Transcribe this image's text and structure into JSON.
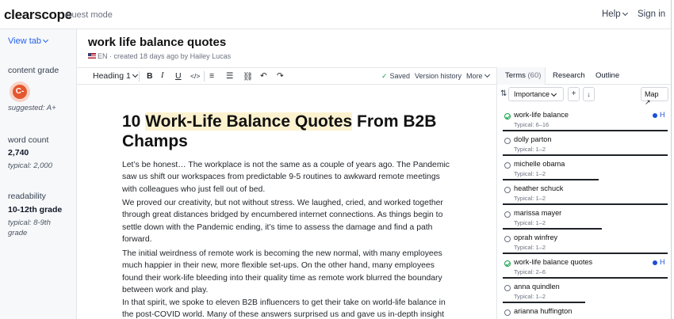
{
  "header": {
    "logo": "clearscope",
    "mode": "Guest mode",
    "help": "Help",
    "signin": "Sign in"
  },
  "sidebar": {
    "view_tab": "View tab",
    "content_grade_label": "content grade",
    "grade": "C-",
    "suggested": "suggested: A+",
    "word_count_label": "word count",
    "word_count": "2,740",
    "word_typical": "typical: 2,000",
    "readability_label": "readability",
    "readability": "10-12th grade",
    "readability_typical": "typical: 8-9th grade"
  },
  "document": {
    "title": "work life balance quotes",
    "lang": "EN",
    "meta": "created 18 days ago by Hailey Lucas"
  },
  "toolbar": {
    "heading": "Heading 1",
    "bold": "B",
    "italic": "I",
    "underline": "U",
    "code": "</>",
    "bullets": "≡",
    "numbers": "☰",
    "link": "⛓",
    "undo": "↶",
    "redo": "↷",
    "saved": "Saved",
    "version_history": "Version history",
    "more": "More"
  },
  "editor": {
    "h1_pre": "10 ",
    "h1_highlight": "Work-Life Balance Quotes",
    "h1_post": " From B2B Champs",
    "paragraphs": [
      "Let’s be honest… The workplace is not the same as a couple of years ago. The Pandemic saw us shift our workspaces from predictable 9-5 routines to awkward remote meetings with colleagues who just fell out of bed.",
      "We proved our creativity, but not without stress. We laughed, cried, and worked together through great distances bridged by encumbered internet connections. As things begin to settle down with the Pandemic ending, it’s time to assess the damage and find a path forward.",
      "The initial weirdness of remote work is becoming the new normal, with many employees much happier in their new, more flexible set-ups. On the other hand, many employees found their work-life bleeding into their quality time as remote work blurred the boundary between work and play.",
      "In that spirit, we spoke to eleven B2B influencers to get their take on world-life balance in the post-COVID world. Many of these answers surprised us and gave us in-depth insight into"
    ]
  },
  "panel": {
    "tabs": [
      {
        "label": "Terms",
        "count": "(60)"
      },
      {
        "label": "Research"
      },
      {
        "label": "Outline"
      }
    ],
    "sort": "Importance",
    "add": "+",
    "download": "↓",
    "map": "Map",
    "terms": [
      {
        "name": "work-life balance",
        "typical": "Typical: 6–16",
        "done": true,
        "heading": "H",
        "fill": 1.0
      },
      {
        "name": "dolly parton",
        "typical": "Typical: 1–2",
        "done": false,
        "heading": "",
        "fill": 1.0
      },
      {
        "name": "michelle obama",
        "typical": "Typical: 1–2",
        "done": false,
        "heading": "",
        "fill": 0.58
      },
      {
        "name": "heather schuck",
        "typical": "Typical: 1–2",
        "done": false,
        "heading": "",
        "fill": 1.0
      },
      {
        "name": "marissa mayer",
        "typical": "Typical: 1–2",
        "done": false,
        "heading": "",
        "fill": 0.6
      },
      {
        "name": "oprah winfrey",
        "typical": "Typical: 1–2",
        "done": false,
        "heading": "",
        "fill": 1.0
      },
      {
        "name": "work-life balance quotes",
        "typical": "Typical: 2–6",
        "done": true,
        "heading": "H",
        "fill": 1.0
      },
      {
        "name": "anna quindlen",
        "typical": "Typical: 1–2",
        "done": false,
        "heading": "",
        "fill": 0.5
      },
      {
        "name": "arianna huffington",
        "typical": "",
        "done": false,
        "heading": "",
        "fill": 0
      }
    ]
  }
}
